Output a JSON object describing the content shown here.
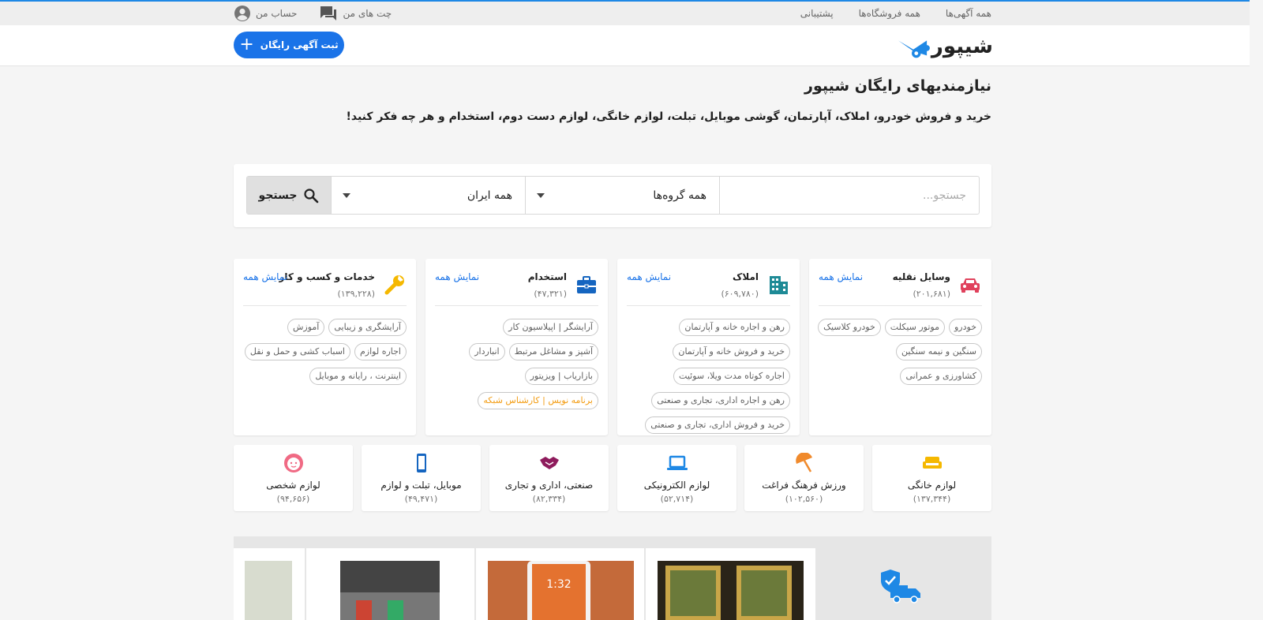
{
  "topbar": {
    "links": [
      "همه آگهی‌ها",
      "همه فروشگاه‌ها",
      "پشتیبانی"
    ],
    "chat_label": "چت های من",
    "account_label": "حساب من"
  },
  "header": {
    "logo_text": "شیپور",
    "post_button": "ثبت آگهی رایگان"
  },
  "hero": {
    "title": "نیازمندیهای رایگان شیپور",
    "subtitle": "خرید و فروش خودرو، املاک، آپارتمان، گوشی موبایل، تبلت، لوازم خانگی، لوازم دست دوم، استخدام و هر چه فکر کنید!"
  },
  "search": {
    "placeholder": "جستجو...",
    "category_value": "همه گروه‌ها",
    "location_value": "همه ایران",
    "button_label": "جستجو"
  },
  "show_all_label": "نمایش همه",
  "categories": [
    {
      "name": "وسایل نقلیه",
      "count": "(۲۰۱,۶۸۱)",
      "icon": "car-icon",
      "color": "#e0415c",
      "items": [
        "خودرو",
        "موتور سیکلت",
        "خودرو کلاسیک",
        "سنگین و نیمه سنگین",
        "کشاورزی و عمرانی"
      ]
    },
    {
      "name": "املاک",
      "count": "(۶۰۹,۷۸۰)",
      "icon": "building-icon",
      "color": "#1e8a96",
      "items": [
        "رهن و اجاره خانه و آپارتمان",
        "خرید و فروش خانه و آپارتمان",
        "اجاره کوتاه مدت ویلا، سوئیت",
        "رهن و اجاره اداری، تجاری و صنعتی",
        "خرید و فروش اداری، تجاری و صنعتی"
      ]
    },
    {
      "name": "استخدام",
      "count": "(۴۷,۳۲۱)",
      "icon": "briefcase-icon",
      "color": "#1565c0",
      "items": [
        "آرایشگر | اپیلاسیون کار",
        "آشپز و مشاغل مرتبط",
        "انباردار",
        "بازاریاب | ویزیتور",
        "برنامه نویس | کارشناس شبکه"
      ]
    },
    {
      "name": "خدمات و کسب و کار",
      "count": "(۱۳۹,۲۲۸)",
      "icon": "wrench-icon",
      "color": "#f5b800",
      "items": [
        "آرایشگری و زیبایی",
        "آموزش",
        "اجاره لوازم",
        "اسباب کشی و حمل و نقل",
        "اینترنت ، رایانه و موبایل"
      ]
    }
  ],
  "small_categories": [
    {
      "name": "لوازم خانگی",
      "count": "(۱۳۷,۳۴۴)",
      "icon": "sofa-icon",
      "color": "#f5b800"
    },
    {
      "name": "ورزش فرهنگ فراغت",
      "count": "(۱۰۲,۵۶۰)",
      "icon": "umbrella-icon",
      "color": "#f08a2c"
    },
    {
      "name": "لوازم الکترونیکی",
      "count": "(۵۲,۷۱۴)",
      "icon": "laptop-icon",
      "color": "#1e88e5"
    },
    {
      "name": "صنعتی، اداری و تجاری",
      "count": "(۸۲,۳۳۴)",
      "icon": "handshake-icon",
      "color": "#8e1b5c"
    },
    {
      "name": "موبایل، تبلت و لوازم",
      "count": "(۴۹,۴۷۱)",
      "icon": "mobile-icon",
      "color": "#1565c0"
    },
    {
      "name": "لوازم شخصی",
      "count": "(۹۴,۶۵۶)",
      "icon": "baby-face-icon",
      "color": "#f06a84"
    }
  ],
  "promo": {
    "phone_time": "1:32",
    "colors": {
      "background": "#e6e6e6",
      "truck": "#1e88e5"
    }
  },
  "colors": {
    "accent": "#1a73e8",
    "top_line": "#1e88e5",
    "orange_chip": "#f39c12"
  }
}
